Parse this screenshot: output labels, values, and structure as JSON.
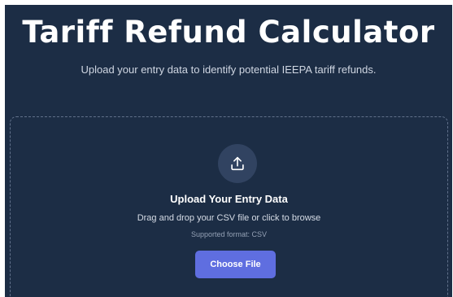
{
  "header": {
    "title": "Tariff Refund Calculator",
    "subtitle": "Upload your entry data to identify potential IEEPA tariff refunds."
  },
  "upload": {
    "icon": "upload-icon",
    "title": "Upload Your Entry Data",
    "instructions": "Drag and drop your CSV file or click to browse",
    "supported_format": "Supported format: CSV",
    "button_label": "Choose File"
  },
  "colors": {
    "background": "#1c2d45",
    "accent": "#5f6ee0",
    "icon_circle": "#314361",
    "dropzone_border": "#61718b"
  }
}
